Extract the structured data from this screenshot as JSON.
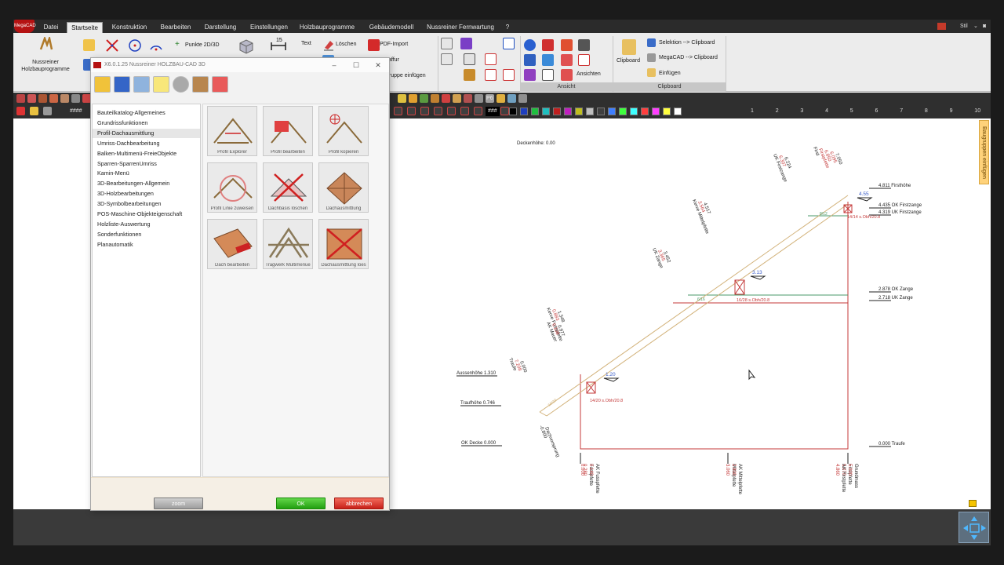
{
  "ribbon": {
    "tabs": [
      "Datei",
      "Startseite",
      "Konstruktion",
      "Bearbeiten",
      "Darstellung",
      "Einstellungen",
      "Holzbauprogramme",
      "Gebäudemodell",
      "Nussreiner Fernwartung",
      "?"
    ],
    "active_tab": "Startseite",
    "style_label": "Stil",
    "app_logo": "MegaCAD",
    "holzbau_button": "Nussreiner Holzbauprogramme",
    "punkte_label": "Punkte 2D/3D",
    "text_label": "Text",
    "loeschen_label": "Löschen",
    "pdf_import_label": "PDF-Import",
    "schraffur_label": "affur",
    "gruppe_label": "gruppe einfügen",
    "ansichten_label": "Ansichten",
    "ansicht_group": "Ansicht",
    "clipboard_button": "Clipboard",
    "sel_clip": "Selektion --> Clipboard",
    "mega_clip": "MegaCAD --> Clipboard",
    "einfuegen": "Einfügen",
    "clipboard_group": "Clipboard"
  },
  "toolbar": {
    "hash1": "####",
    "hash2": "###",
    "p6": "P6",
    "ruler": [
      "1",
      "2",
      "3",
      "4",
      "5",
      "6",
      "7",
      "8",
      "9",
      "10"
    ],
    "colors": [
      "#000000",
      "#1f3fbf",
      "#1fbf3f",
      "#1fbfbf",
      "#bf1f1f",
      "#bf1fbf",
      "#bfbf1f",
      "#bfbfbf",
      "#3f3f3f",
      "#3f7fff",
      "#3fff3f",
      "#3fffff",
      "#ff3f3f",
      "#ff3fff",
      "#ffff3f",
      "#ffffff"
    ]
  },
  "side_tab": "Baugruppen einfügen",
  "dialog": {
    "title": "X6.0.1.25 Nussreiner HOLZBAU-CAD 3D",
    "menu": [
      "Bauteilkatalog-Allgemeines",
      "Grundrissfunktionen",
      "Profil-Dachausmittlung",
      "Umriss-Dachbearbeitung",
      "Balken-Multimenü-FreieObjekte",
      "Sparren-SparrenUmriss",
      "Kamin-Menü",
      "3D-Bearbeitungen-Allgemein",
      "3D-Holzbearbeitungen",
      "3D-Symbolbearbeitungen",
      "POS-Maschine-Objekteigenschaft",
      "Holzliste-Auswertung",
      "Sonderfunktionen",
      "Planautomatik"
    ],
    "selected_menu": 2,
    "tiles": [
      "Profil Explorer",
      "Profil bearbeiten",
      "Profil kopieren",
      "Profil Linie zuweisen",
      "Dachbasis löschen",
      "Dachausmittlung",
      "Dach bearbeiten",
      "Tragwerk Multimenue",
      "Dachausmittlung loes"
    ],
    "zoom": "zoom",
    "ok": "OK",
    "cancel": "abbrechen"
  },
  "drawing": {
    "deckenhoehe": "Deckenhöhe: 0.00",
    "right_levels": [
      {
        "v": "4.811",
        "t": "Firsthöhe"
      },
      {
        "v": "4.435",
        "t": "OK Firstzange"
      },
      {
        "v": "4.319",
        "t": "UK Firstzange"
      },
      {
        "v": "2.878",
        "t": "OK Zange"
      },
      {
        "v": "2.718",
        "t": "UK Zange"
      },
      {
        "v": "0.000",
        "t": "Traufe"
      }
    ],
    "left_levels": [
      {
        "t": "Aussenhöhe",
        "v": "1.310"
      },
      {
        "t": "Traufhöhe",
        "v": "0.746"
      },
      {
        "t": "OK Decke",
        "v": "0.000"
      }
    ],
    "slope_labels": [
      "4.55",
      "3.13",
      "1.20"
    ],
    "section_labels": [
      "14/14 s.Obh/20.8",
      "16/28 s.Obh/20.8",
      "14/20 s.Obh/20.8"
    ],
    "pitch_labels": [
      "8/12",
      "6/16",
      "10/20"
    ],
    "diag_labels": [
      {
        "lines": [
          "First",
          "Firstpfette",
          "6.850",
          "6.095",
          "7.050"
        ]
      },
      {
        "lines": [
          "UK Firstzange",
          "6.307",
          "6.224"
        ]
      },
      {
        "lines": [
          "Kerve Mittelpfette",
          "3.564",
          "4.517"
        ]
      },
      {
        "lines": [
          "UK Zange",
          "3.365",
          "3.452"
        ]
      },
      {
        "lines": [
          "Kerve Fusspfette",
          "0.883",
          "1.348"
        ]
      },
      {
        "lines": [
          "AK Mauer",
          "6.108",
          "0.977"
        ]
      },
      {
        "lines": [
          "Traufe",
          "7.208",
          "0.000"
        ]
      },
      {
        "lines": [
          "-0.800",
          "Dachvorsprung"
        ]
      }
    ],
    "bottom_labels": [
      {
        "lines": [
          "0.280",
          "Fusspfette"
        ]
      },
      {
        "lines": [
          "0.140",
          "AK Fusspfette"
        ]
      },
      {
        "lines": [
          "0.000"
        ]
      },
      {
        "lines": [
          "3.060",
          "Mittelpfette"
        ]
      },
      {
        "lines": [
          "2.900",
          "AK Mittelpfette"
        ]
      },
      {
        "lines": [
          "5.070",
          "Firstpfette"
        ]
      },
      {
        "lines": [
          "5.000",
          "Grundmass"
        ]
      },
      {
        "lines": [
          "4.860",
          "AK Firstpfette"
        ]
      }
    ]
  }
}
